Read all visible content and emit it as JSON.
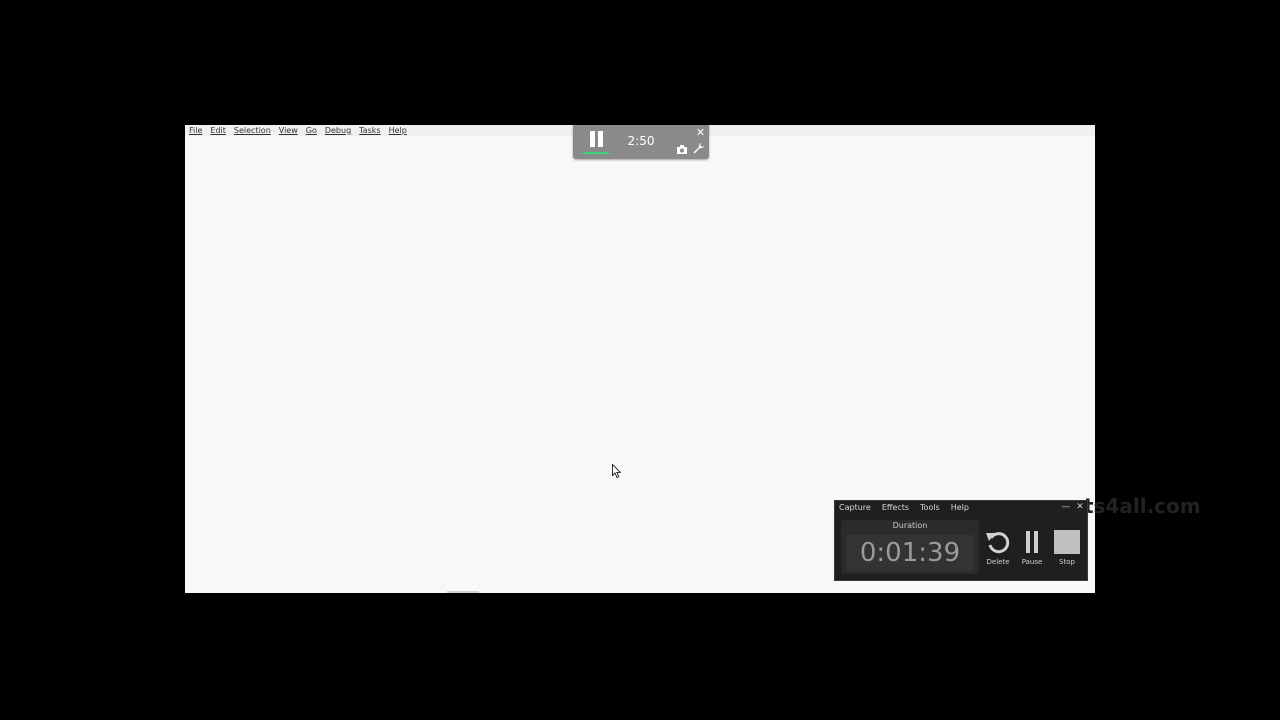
{
  "app": {
    "menu": [
      "File",
      "Edit",
      "Selection",
      "View",
      "Go",
      "Debug",
      "Tasks",
      "Help"
    ]
  },
  "recording_toolbar": {
    "time": "2:50",
    "icons": [
      "pause-icon",
      "close-icon",
      "camera-icon",
      "wrench-icon"
    ],
    "progress_color": "#3fd07a"
  },
  "recorder": {
    "menu": [
      "Capture",
      "Effects",
      "Tools",
      "Help"
    ],
    "duration_label": "Duration",
    "duration_value": "0:01:39",
    "controls": {
      "delete_label": "Delete",
      "pause_label": "Pause",
      "stop_label": "Stop"
    },
    "window_icons": [
      "minimize-icon",
      "close-icon"
    ]
  },
  "watermark": {
    "text": "ts4all.com"
  },
  "colors": {
    "background": "#000000",
    "window": "#f8f8f8",
    "recorder_bg": "#1f1f1f",
    "toolbar_bg": "#8a8a8a"
  }
}
